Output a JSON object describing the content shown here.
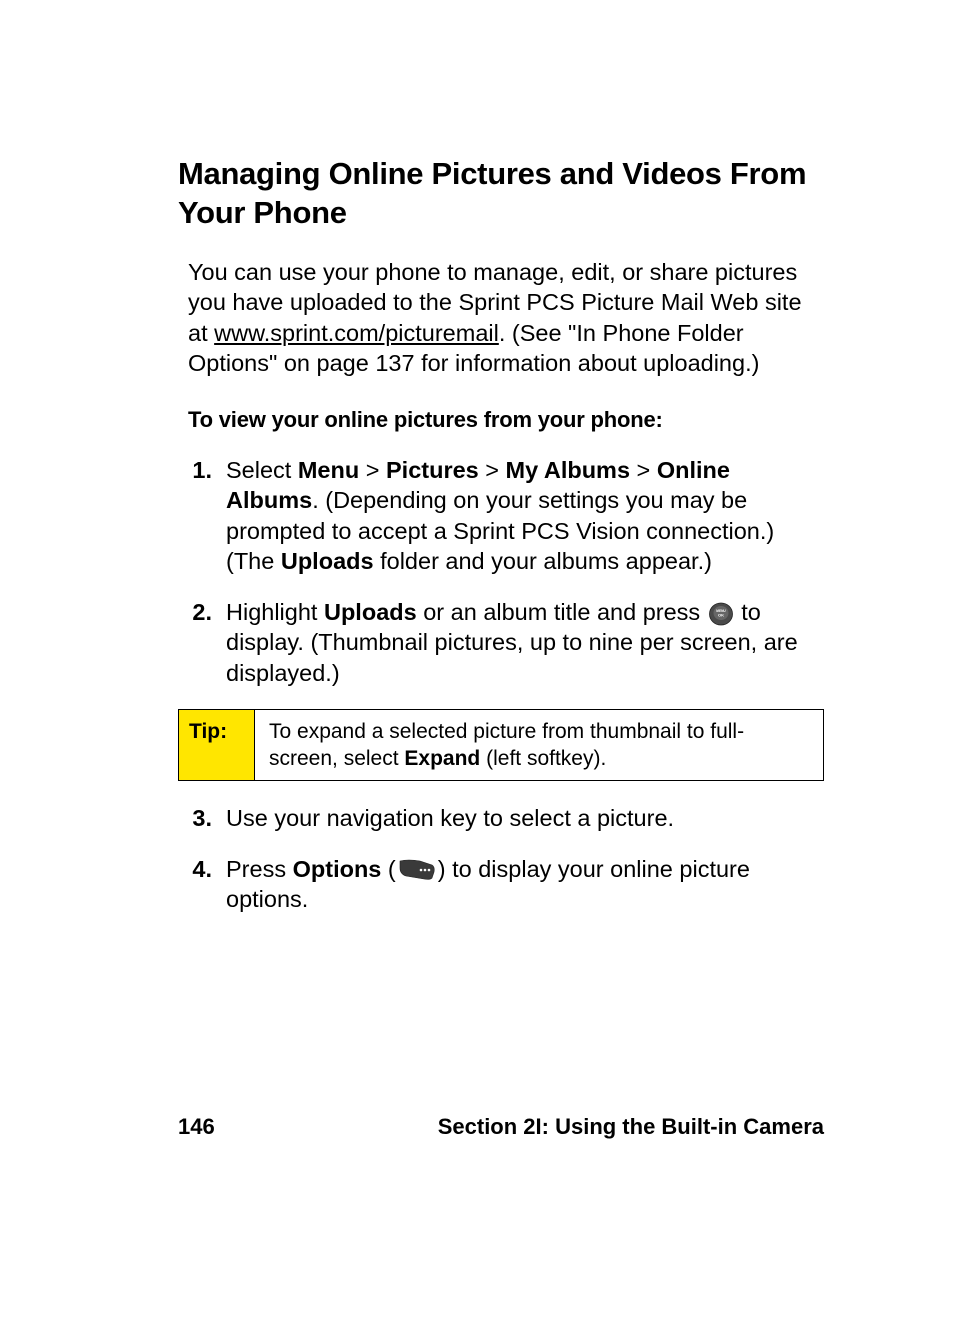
{
  "heading": "Managing Online Pictures and Videos From Your Phone",
  "intro": {
    "part1": "You can use your phone to manage, edit, or share pictures you have uploaded to the Sprint PCS Picture Mail Web site at ",
    "link": "www.sprint.com/picturemail",
    "part2": ". (See \"In Phone Folder Options\" on page 137 for information about uploading.)"
  },
  "subhead": "To view your online pictures from your phone:",
  "steps": {
    "s1": {
      "num": "1.",
      "a": "Select ",
      "menu": "Menu",
      "gt": " > ",
      "pictures": "Pictures",
      "myalbums": "My Albums",
      "online": "Online Albums",
      "b": ". (Depending on your settings you may be prompted to accept a Sprint PCS Vision connection.) (The ",
      "uploads": "Uploads",
      "c": " folder and your albums appear.)"
    },
    "s2": {
      "num": "2.",
      "a": "Highlight ",
      "uploads": "Uploads",
      "b": " or an album title and press ",
      "c": " to display. (Thumbnail pictures, up to nine per screen, are displayed.)"
    },
    "s3": {
      "num": "3.",
      "text": "Use your navigation key to select a picture."
    },
    "s4": {
      "num": "4.",
      "a": "Press ",
      "options": "Options",
      "b": " (",
      "c": ") to display your online picture options."
    }
  },
  "tip": {
    "label": "Tip:",
    "a": "To expand a selected picture from thumbnail to full-screen, select ",
    "expand": "Expand",
    "b": " (left softkey)."
  },
  "footer": {
    "page": "146",
    "section": "Section 2I: Using the Built-in Camera"
  }
}
